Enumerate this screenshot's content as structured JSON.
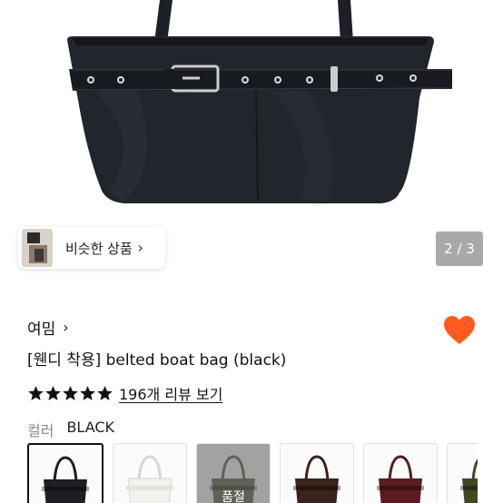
{
  "gallery": {
    "page_indicator": "2 / 3",
    "similar_products_label": "비슷한 상품",
    "similar_products_chevron": "›"
  },
  "product": {
    "brand": "여밈",
    "brand_chevron": "›",
    "title": "[웬디 착용] belted boat bag (black)",
    "rating_stars": 5,
    "review_link": "196개 리뷰 보기",
    "wishlist_icon": "heart-icon",
    "wishlist_color": "#ff5a1f"
  },
  "options": {
    "color_label": "컬러",
    "color_value": "BLACK",
    "swatches": [
      {
        "color": "#1e1f24",
        "selected": true
      },
      {
        "color": "#f3f1ec"
      },
      {
        "color": "#6d6a57",
        "sold_out_label": "품절"
      },
      {
        "color": "#3a231c"
      },
      {
        "color": "#5a1c1f"
      },
      {
        "color": "#3f4a22"
      }
    ]
  }
}
